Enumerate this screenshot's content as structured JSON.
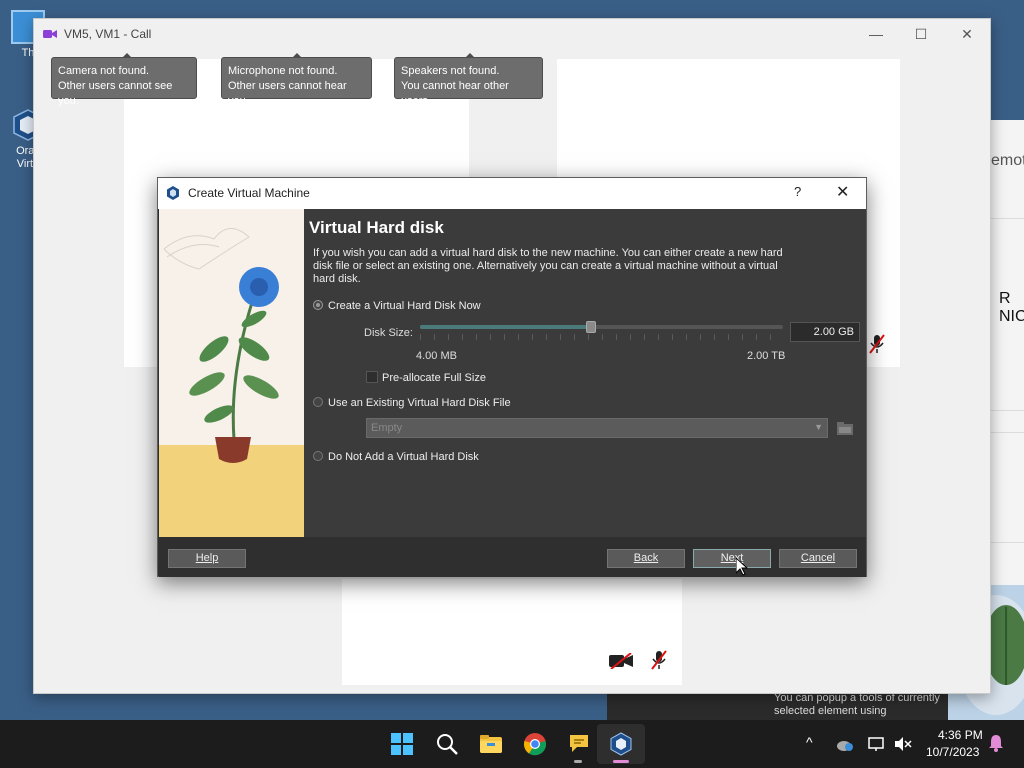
{
  "desktop": {
    "icons": [
      {
        "label": "Th"
      },
      {
        "label": "Orac Virtu"
      }
    ]
  },
  "background_window": {
    "partial_text_1": "emot",
    "partial_text_2": "R NIC",
    "tooltip_text": "You can popup a tools of currently selected element using"
  },
  "call_window": {
    "title": "VM5, VM1 - Call",
    "controls": {
      "minimize": "—",
      "maximize": "☐",
      "close": "✕"
    },
    "notices": [
      {
        "line1": "Camera not found.",
        "line2": "Other users cannot see you."
      },
      {
        "line1": "Microphone not found.",
        "line2": "Other users cannot hear you."
      },
      {
        "line1": "Speakers not found.",
        "line2": "You cannot hear other users."
      }
    ]
  },
  "dialog": {
    "title": "Create Virtual Machine",
    "help_glyph": "?",
    "close_glyph": "✕",
    "heading": "Virtual Hard disk",
    "description": "If you wish you can add a virtual hard disk to the new machine. You can either create a new hard disk file or select an existing one. Alternatively you can create a virtual machine without a virtual hard disk.",
    "options": {
      "create_now": "Create a Virtual Hard Disk Now",
      "use_existing": "Use an Existing Virtual Hard Disk File",
      "do_not_add": "Do Not Add a Virtual Hard Disk"
    },
    "selected_option": "create_now",
    "disk_size_label": "Disk Size:",
    "disk_size_value": "2.00 GB",
    "slider_fraction": 0.47,
    "range_min": "4.00 MB",
    "range_max": "2.00 TB",
    "preallocate_label": "Pre-allocate Full Size",
    "preallocate_checked": false,
    "existing_file_value": "Empty",
    "buttons": {
      "help": "Help",
      "back": "Back",
      "next": "Next",
      "cancel": "Cancel"
    }
  },
  "taskbar": {
    "apps": [
      "start-icon",
      "search-icon",
      "file-explorer-icon",
      "chrome-icon",
      "chat-icon",
      "virtualbox-icon"
    ],
    "clock_time": "4:36 PM",
    "clock_date": "10/7/2023"
  }
}
